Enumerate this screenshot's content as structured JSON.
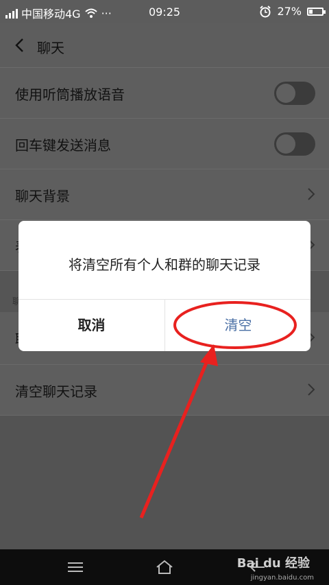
{
  "status_bar": {
    "carrier": "中国移动4G",
    "more": "···",
    "time": "09:25",
    "battery": "27%",
    "battery_level": 0.27,
    "icons": [
      "signal-icon",
      "wifi-icon",
      "alarm-icon",
      "battery-icon"
    ]
  },
  "header": {
    "title": "聊天",
    "back_icon": "chevron-left-icon"
  },
  "settings": {
    "rows": [
      {
        "label": "使用听筒播放语音",
        "control": "toggle",
        "on": false
      },
      {
        "label": "回车键发送消息",
        "control": "toggle",
        "on": false
      },
      {
        "label": "聊天背景",
        "control": "chevron"
      },
      {
        "label": "表",
        "control": "chevron"
      },
      {
        "label": "聊",
        "control": "section-label"
      },
      {
        "label": "聊",
        "control": "chevron"
      },
      {
        "label": "清空聊天记录",
        "control": "chevron"
      }
    ]
  },
  "dialog": {
    "message": "将清空所有个人和群的聊天记录",
    "cancel_label": "取消",
    "confirm_label": "清空",
    "confirm_color": "#4a6fa5"
  },
  "annotation": {
    "color": "#e8211f"
  },
  "nav_bar": {
    "icons": [
      "menu-icon",
      "home-icon",
      "back-icon"
    ]
  },
  "watermark": {
    "text": "Bai du 经验",
    "url": "jingyan.baidu.com"
  }
}
